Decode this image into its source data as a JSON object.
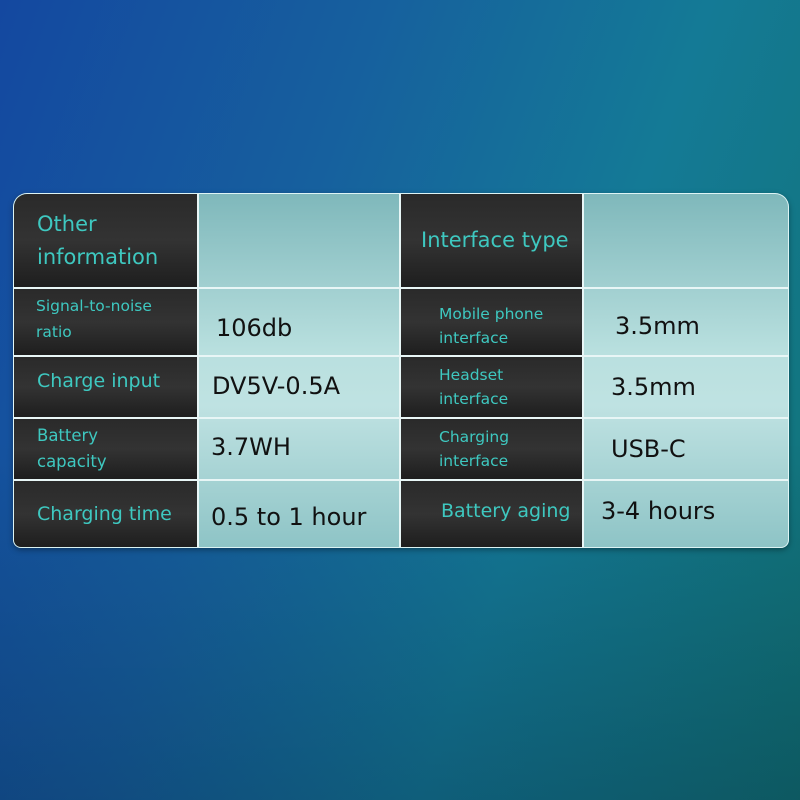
{
  "colors": {
    "label_text": "#3ec8c0",
    "value_text": "#111111",
    "label_bg": "#2a2a2a",
    "value_bg": "#b9e0df"
  },
  "left": {
    "header": "Other information",
    "rows": [
      {
        "label": "Signal-to-noise ratio",
        "value": "106db"
      },
      {
        "label": "Charge input",
        "value": "DV5V-0.5A"
      },
      {
        "label": "Battery capacity",
        "value": "3.7WH"
      },
      {
        "label": "Charging time",
        "value": "0.5 to 1 hour"
      }
    ]
  },
  "right": {
    "header": "Interface type",
    "rows": [
      {
        "label": "Mobile phone interface",
        "value": "3.5mm"
      },
      {
        "label": "Headset interface",
        "value": "3.5mm"
      },
      {
        "label": "Charging interface",
        "value": "USB-C"
      },
      {
        "label": "Battery aging",
        "value": "3-4 hours"
      }
    ]
  }
}
